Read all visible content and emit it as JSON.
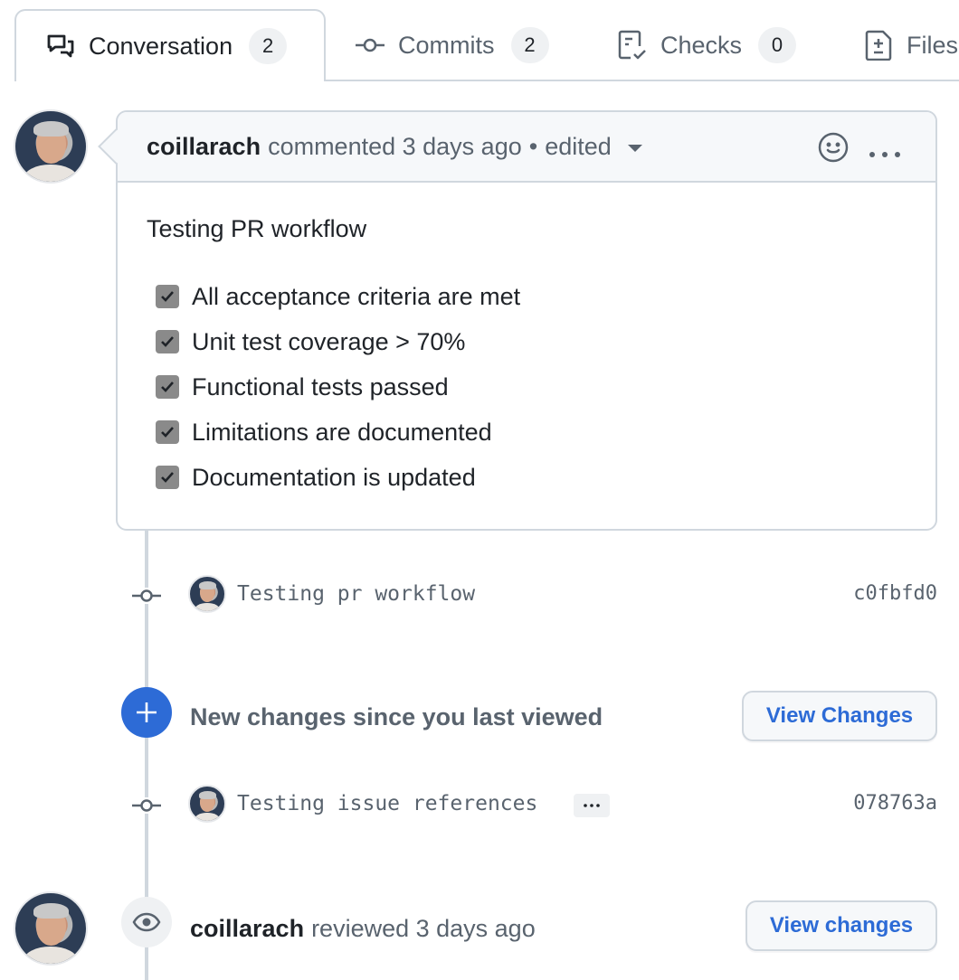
{
  "tabs": [
    {
      "label": "Conversation",
      "count": "2",
      "icon": "comment-discussion-icon",
      "active": true
    },
    {
      "label": "Commits",
      "count": "2",
      "icon": "git-commit-icon",
      "active": false
    },
    {
      "label": "Checks",
      "count": "0",
      "icon": "checklist-icon",
      "active": false
    },
    {
      "label": "Files",
      "icon": "file-diff-icon",
      "active": false
    }
  ],
  "comment": {
    "author": "coillarach",
    "action": "commented 3 days ago",
    "separator": "•",
    "edited": "edited",
    "title": "Testing PR workflow",
    "tasks": [
      {
        "label": "All acceptance criteria are met",
        "checked": true
      },
      {
        "label": "Unit test coverage > 70%",
        "checked": true
      },
      {
        "label": "Functional tests passed",
        "checked": true
      },
      {
        "label": "Limitations are documented",
        "checked": true
      },
      {
        "label": "Documentation is updated",
        "checked": true
      }
    ]
  },
  "commits": [
    {
      "message": "Testing pr workflow",
      "sha": "c0fbfd0"
    },
    {
      "message": "Testing issue references",
      "sha": "078763a",
      "ellipsis": "…"
    }
  ],
  "new_changes": {
    "text": "New changes since you last viewed",
    "button": "View Changes"
  },
  "review": {
    "author": "coillarach",
    "action": "reviewed 3 days ago",
    "button": "View changes"
  },
  "colors": {
    "accent": "#2d6bd6",
    "border": "#d0d7de",
    "muted": "#59636e",
    "text": "#1f2328"
  }
}
